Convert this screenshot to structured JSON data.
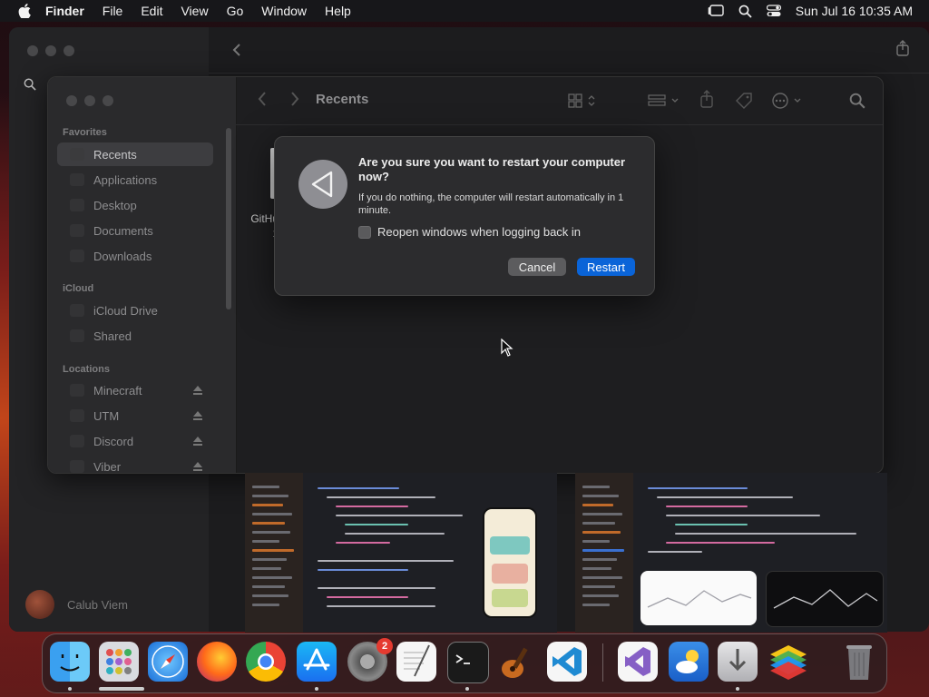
{
  "menubar": {
    "items": [
      "Finder",
      "File",
      "Edit",
      "View",
      "Go",
      "Window",
      "Help"
    ],
    "clock": "Sun Jul 16  10:35 AM"
  },
  "back_window": {
    "user_name": "Calub Viem"
  },
  "finder": {
    "title": "Recents",
    "sections": {
      "favorites": "Favorites",
      "icloud": "iCloud",
      "locations": "Locations"
    },
    "favorites": [
      "Recents",
      "Applications",
      "Desktop",
      "Documents",
      "Downloads"
    ],
    "icloud": [
      "iCloud Drive",
      "Shared"
    ],
    "locations": [
      "Minecraft",
      "UTM",
      "Discord",
      "Viber"
    ],
    "file_label_1": "GitHu",
    "file_label_2": "x"
  },
  "dialog": {
    "title": "Are you sure you want to restart your computer now?",
    "message": "If you do nothing, the computer will restart automatically in 1 minute.",
    "checkbox_label": "Reopen windows when logging back in",
    "checkbox_checked": false,
    "cancel_label": "Cancel",
    "restart_label": "Restart",
    "icon": "restart-icon"
  },
  "dock": {
    "apps": [
      "Finder",
      "Launchpad",
      "Safari",
      "Firefox",
      "Chrome",
      "App Store",
      "System Settings",
      "TextEdit",
      "Terminal",
      "GarageBand",
      "Visual Studio Code",
      "Visual Studio",
      "Weather",
      "Downloads",
      "BlueStacks",
      "Trash"
    ],
    "settings_badge": "2"
  },
  "colors": {
    "accent": "#0a64d8",
    "menubar": "#17171a"
  }
}
